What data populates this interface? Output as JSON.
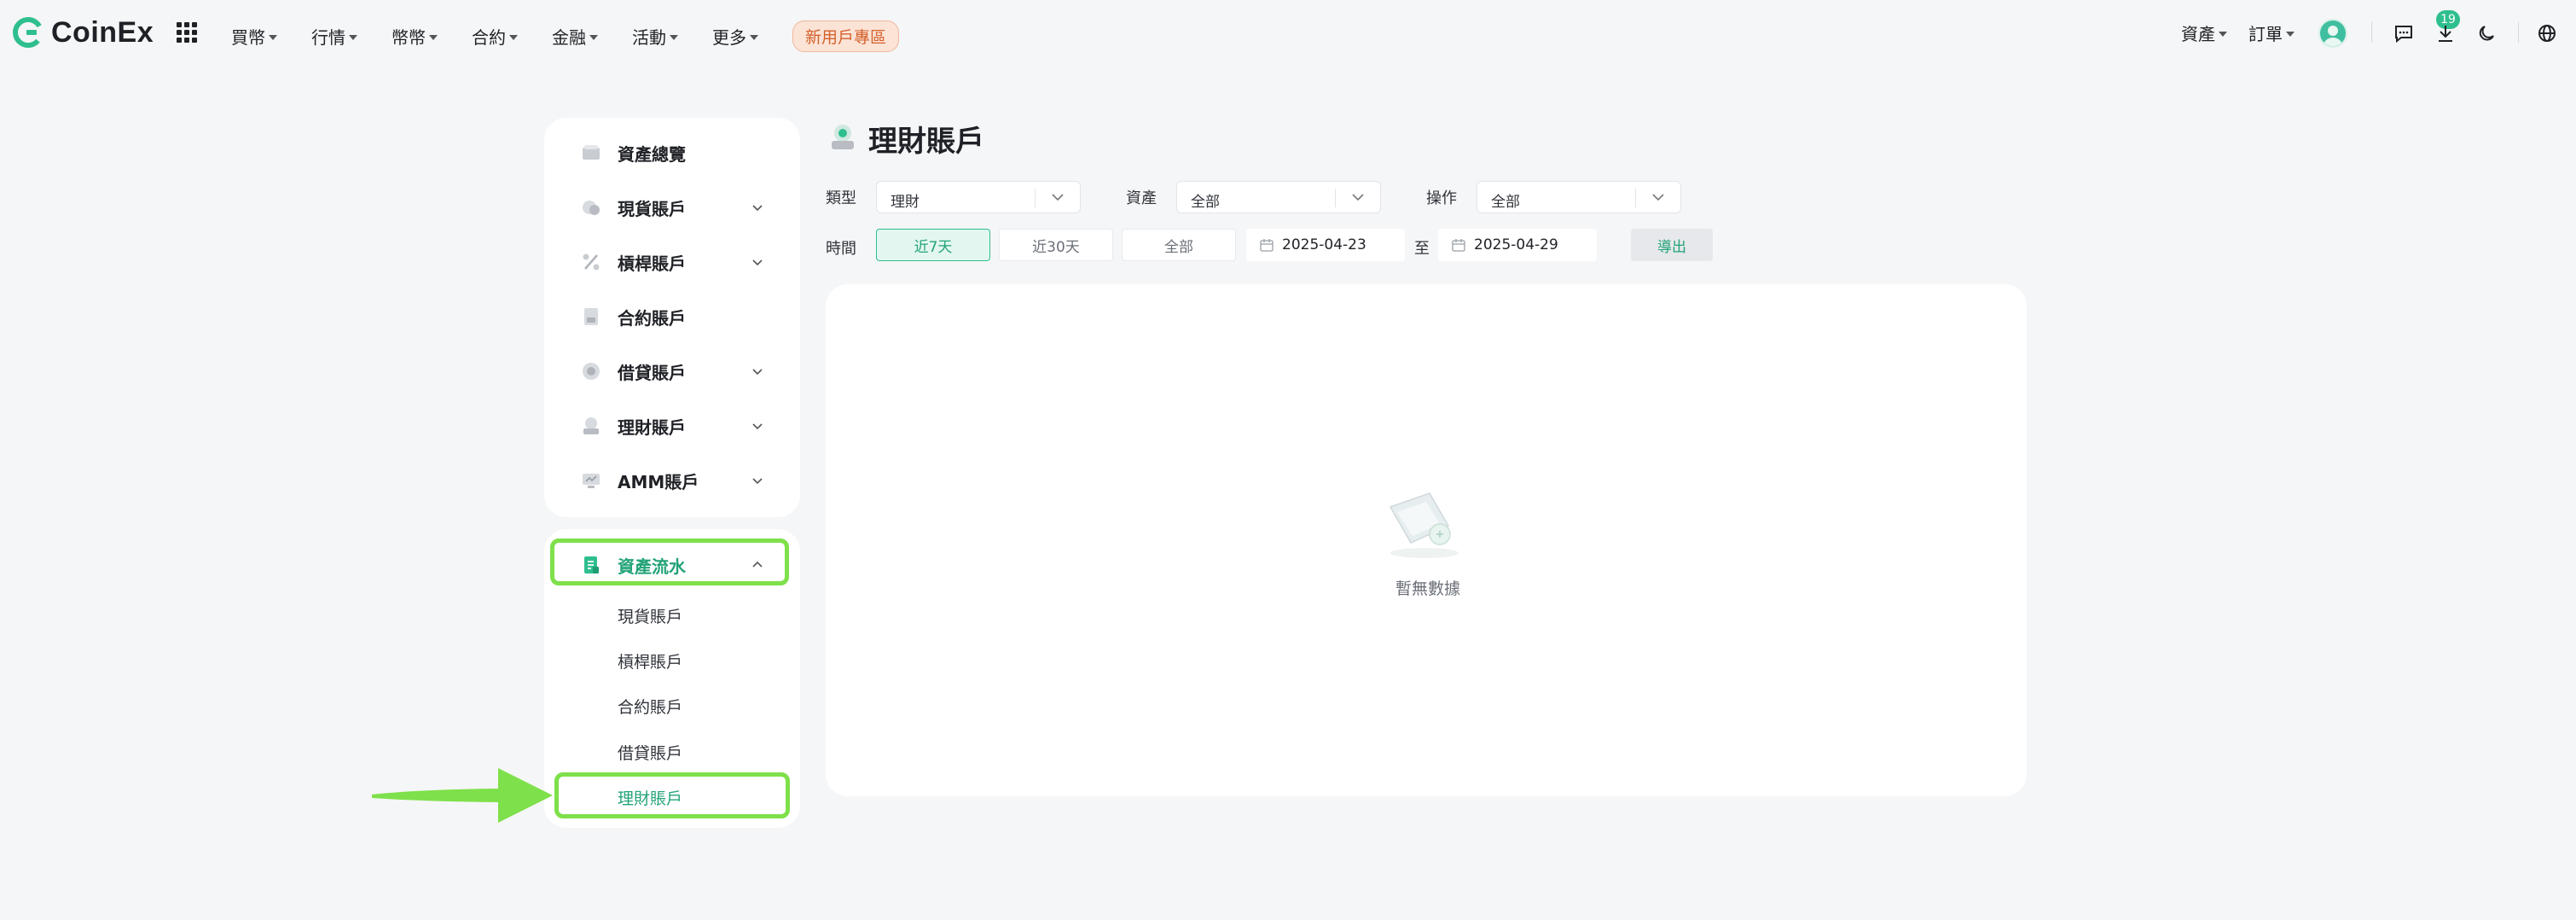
{
  "brand": {
    "name": "CoinEx"
  },
  "nav": {
    "items": [
      {
        "label": "買幣"
      },
      {
        "label": "行情"
      },
      {
        "label": "幣幣"
      },
      {
        "label": "合約"
      },
      {
        "label": "金融"
      },
      {
        "label": "活動"
      },
      {
        "label": "更多"
      }
    ],
    "promo": "新用戶專區",
    "right": {
      "assets": "資產",
      "orders": "訂單",
      "notification_count": "19"
    }
  },
  "sidebar": {
    "top_items": [
      {
        "label": "資產總覽",
        "icon": "overview-icon",
        "expandable": false
      },
      {
        "label": "現貨賬戶",
        "icon": "spot-icon",
        "expandable": true
      },
      {
        "label": "槓桿賬戶",
        "icon": "margin-icon",
        "expandable": true
      },
      {
        "label": "合約賬戶",
        "icon": "futures-icon",
        "expandable": false
      },
      {
        "label": "借貸賬戶",
        "icon": "loan-icon",
        "expandable": true
      },
      {
        "label": "理財賬戶",
        "icon": "financial-icon",
        "expandable": true
      },
      {
        "label": "AMM賬戶",
        "icon": "amm-icon",
        "expandable": true
      }
    ],
    "history": {
      "label": "資產流水",
      "expanded": true,
      "sub_items": [
        {
          "label": "現貨賬戶"
        },
        {
          "label": "槓桿賬戶"
        },
        {
          "label": "合約賬戶"
        },
        {
          "label": "借貸賬戶"
        },
        {
          "label": "理財賬戶",
          "active": true
        }
      ]
    }
  },
  "main": {
    "title": "理財賬戶",
    "filters": {
      "type_label": "類型",
      "type_value": "理財",
      "asset_label": "資產",
      "asset_value": "全部",
      "action_label": "操作",
      "action_value": "全部"
    },
    "time": {
      "label": "時間",
      "options": [
        "近7天",
        "近30天",
        "全部"
      ],
      "active_index": 0,
      "start_date": "2025-04-23",
      "to_label": "至",
      "end_date": "2025-04-29",
      "export_label": "導出"
    },
    "empty_text": "暫無數據"
  },
  "colors": {
    "accent": "#2fbf8f",
    "highlight": "#7ee04a",
    "promo": "#d5612b"
  }
}
